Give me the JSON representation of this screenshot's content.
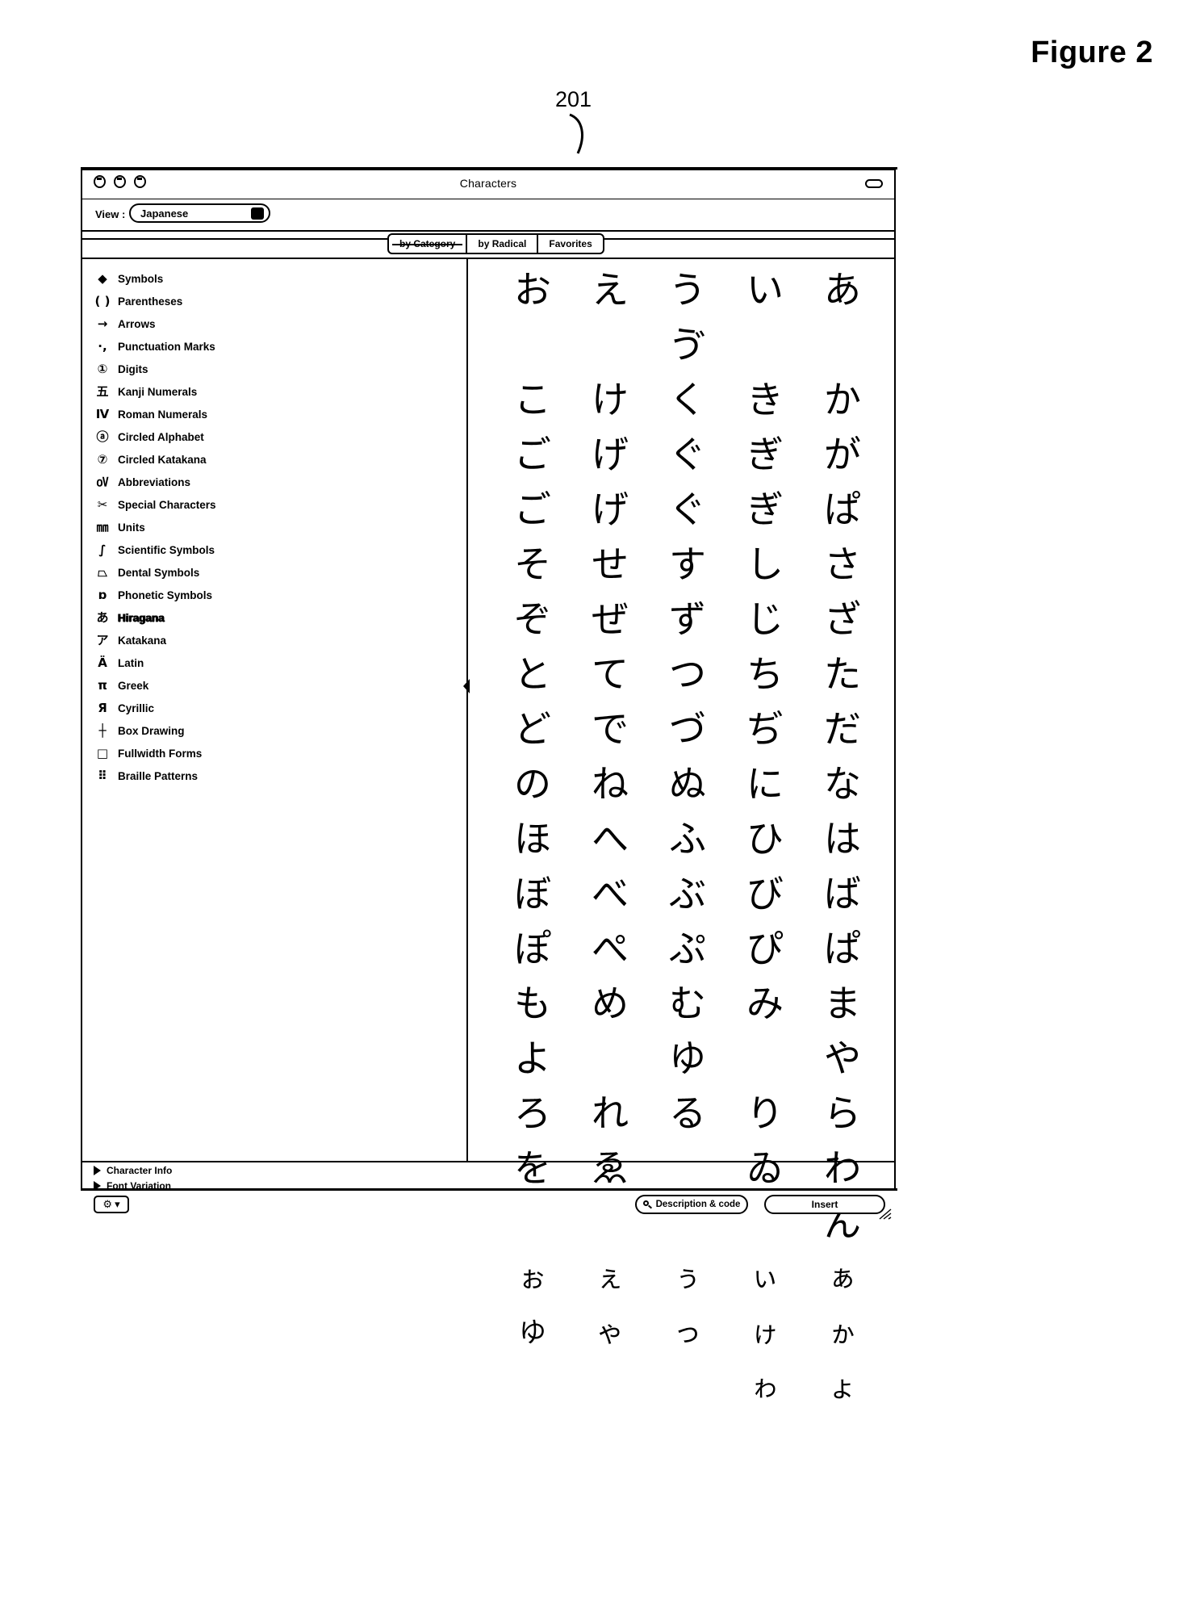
{
  "figure": {
    "title": "Figure 2",
    "callout": "201"
  },
  "window": {
    "title": "Characters",
    "traffic_lights": [
      "close-button",
      "minimize-button",
      "zoom-button"
    ],
    "titlebar_toggle_icon": "pill-toggle-icon"
  },
  "view": {
    "label": "View :",
    "value": "Japanese"
  },
  "tabs": [
    {
      "label": "by Category",
      "selected": true
    },
    {
      "label": "by Radical",
      "selected": false
    },
    {
      "label": "Favorites",
      "selected": false
    }
  ],
  "sidebar": {
    "items": [
      {
        "icon": "◆",
        "icon_name": "diamond-icon",
        "label": "Symbols",
        "selected": false
      },
      {
        "icon": "( )",
        "icon_name": "parentheses-icon",
        "label": "Parentheses",
        "selected": false
      },
      {
        "icon": "→",
        "icon_name": "arrow-right-icon",
        "label": "Arrows",
        "selected": false
      },
      {
        "icon": "·,",
        "icon_name": "punctuation-icon",
        "label": "Punctuation Marks",
        "selected": false
      },
      {
        "icon": "①",
        "icon_name": "circled-digit-one-icon",
        "label": "Digits",
        "selected": false
      },
      {
        "icon": "五",
        "icon_name": "kanji-numeral-icon",
        "label": "Kanji Numerals",
        "selected": false
      },
      {
        "icon": "Ⅳ",
        "icon_name": "roman-numeral-four-icon",
        "label": "Roman Numerals",
        "selected": false
      },
      {
        "icon": "ⓐ",
        "icon_name": "circled-letter-a-icon",
        "label": "Circled Alphabet",
        "selected": false
      },
      {
        "icon": "⑦",
        "icon_name": "circled-katakana-icon",
        "label": "Circled Katakana",
        "selected": false
      },
      {
        "icon": "㍵",
        "icon_name": "abbreviation-icon",
        "label": "Abbreviations",
        "selected": false
      },
      {
        "icon": "✂",
        "icon_name": "special-characters-icon",
        "label": "Special Characters",
        "selected": false
      },
      {
        "icon": "㎜",
        "icon_name": "units-icon",
        "label": "Units",
        "selected": false
      },
      {
        "icon": "∫",
        "icon_name": "integral-icon",
        "label": "Scientific Symbols",
        "selected": false
      },
      {
        "icon": "⏢",
        "icon_name": "dental-symbol-icon",
        "label": "Dental Symbols",
        "selected": false
      },
      {
        "icon": "ɒ",
        "icon_name": "phonetic-symbol-icon",
        "label": "Phonetic Symbols",
        "selected": false
      },
      {
        "icon": "あ",
        "icon_name": "hiragana-a-icon",
        "label": "Hiragana",
        "selected": true
      },
      {
        "icon": "ア",
        "icon_name": "katakana-a-icon",
        "label": "Katakana",
        "selected": false
      },
      {
        "icon": "Ä",
        "icon_name": "latin-a-icon",
        "label": "Latin",
        "selected": false
      },
      {
        "icon": "π",
        "icon_name": "greek-pi-icon",
        "label": "Greek",
        "selected": false
      },
      {
        "icon": "Я",
        "icon_name": "cyrillic-ya-icon",
        "label": "Cyrillic",
        "selected": false
      },
      {
        "icon": "┼",
        "icon_name": "box-drawing-icon",
        "label": "Box Drawing",
        "selected": false
      },
      {
        "icon": "□",
        "icon_name": "fullwidth-square-icon",
        "label": "Fullwidth Forms",
        "selected": false
      },
      {
        "icon": "⠿",
        "icon_name": "braille-icon",
        "label": "Braille Patterns",
        "selected": false
      }
    ]
  },
  "grid": {
    "category": "Hiragana",
    "columns": [
      [
        "あ",
        "",
        "か",
        "が",
        "ぱ",
        "さ",
        "ざ",
        "た",
        "だ",
        "な",
        "は",
        "ば",
        "ぱ",
        "ま",
        "や",
        "ら",
        "わ",
        "ん",
        "ぁ",
        "ゕ",
        "ょ"
      ],
      [
        "い",
        "",
        "き",
        "ぎ",
        "ぎ",
        "し",
        "じ",
        "ち",
        "ぢ",
        "に",
        "ひ",
        "び",
        "ぴ",
        "み",
        "",
        "り",
        "ゐ",
        "",
        "ぃ",
        "ゖ",
        "ゎ"
      ],
      [
        "う",
        "ゔ",
        "く",
        "ぐ",
        "ぐ",
        "す",
        "ず",
        "つ",
        "づ",
        "ぬ",
        "ふ",
        "ぶ",
        "ぷ",
        "む",
        "ゆ",
        "る",
        "",
        "",
        "ぅ",
        "っ",
        ""
      ],
      [
        "え",
        "",
        "け",
        "げ",
        "げ",
        "せ",
        "ぜ",
        "て",
        "で",
        "ね",
        "へ",
        "べ",
        "ぺ",
        "め",
        "",
        "れ",
        "ゑ",
        "",
        "ぇ",
        "ゃ",
        ""
      ],
      [
        "お",
        "",
        "こ",
        "ご",
        "ご",
        "そ",
        "ぞ",
        "と",
        "ど",
        "の",
        "ほ",
        "ぼ",
        "ぽ",
        "も",
        "よ",
        "ろ",
        "を",
        "",
        "ぉ",
        "ゆ",
        ""
      ]
    ]
  },
  "bottom": {
    "character_info_label": "Character Info",
    "font_variation_label": "Font Variation",
    "gear_button_label": "⚙",
    "gear_button_caret": "▾",
    "description_code_label": "Description & code",
    "insert_label": "Insert"
  }
}
